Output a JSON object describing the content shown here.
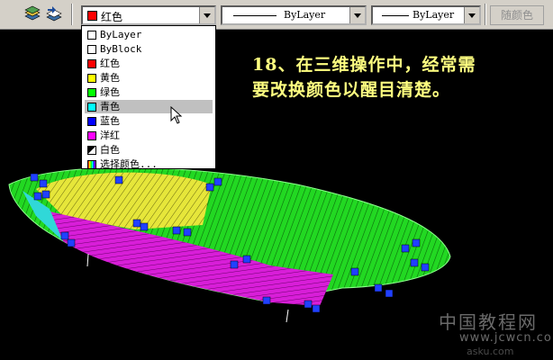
{
  "toolbar": {
    "color_combo": {
      "value": "红色",
      "swatch_color": "#ff0000"
    },
    "linetype_combo": {
      "value": "ByLayer"
    },
    "lineweight_combo": {
      "value": "ByLayer"
    },
    "plotstyle_button": {
      "label": "随颜色"
    },
    "icons": [
      "layers-icon",
      "layer-previous-icon"
    ]
  },
  "color_dropdown": {
    "items": [
      {
        "label": "ByLayer",
        "color": "#ffffff"
      },
      {
        "label": "ByBlock",
        "color": "#ffffff"
      },
      {
        "label": "红色",
        "color": "#ff0000"
      },
      {
        "label": "黄色",
        "color": "#ffff00"
      },
      {
        "label": "绿色",
        "color": "#00ff00"
      },
      {
        "label": "青色",
        "color": "#00ffff",
        "selected": true
      },
      {
        "label": "蓝色",
        "color": "#0000ff"
      },
      {
        "label": "洋红",
        "color": "#ff00ff"
      },
      {
        "label": "白色",
        "color": "split-black-white"
      },
      {
        "label": "选择颜色...",
        "color": "palette"
      }
    ]
  },
  "caption": {
    "line1": "18、在三维操作中，经常需",
    "line2": "要改换颜色以醒目清楚。"
  },
  "watermark": {
    "line1": "中国教程网",
    "line2": "www.jcwcn.com",
    "line3": "asku.com"
  }
}
